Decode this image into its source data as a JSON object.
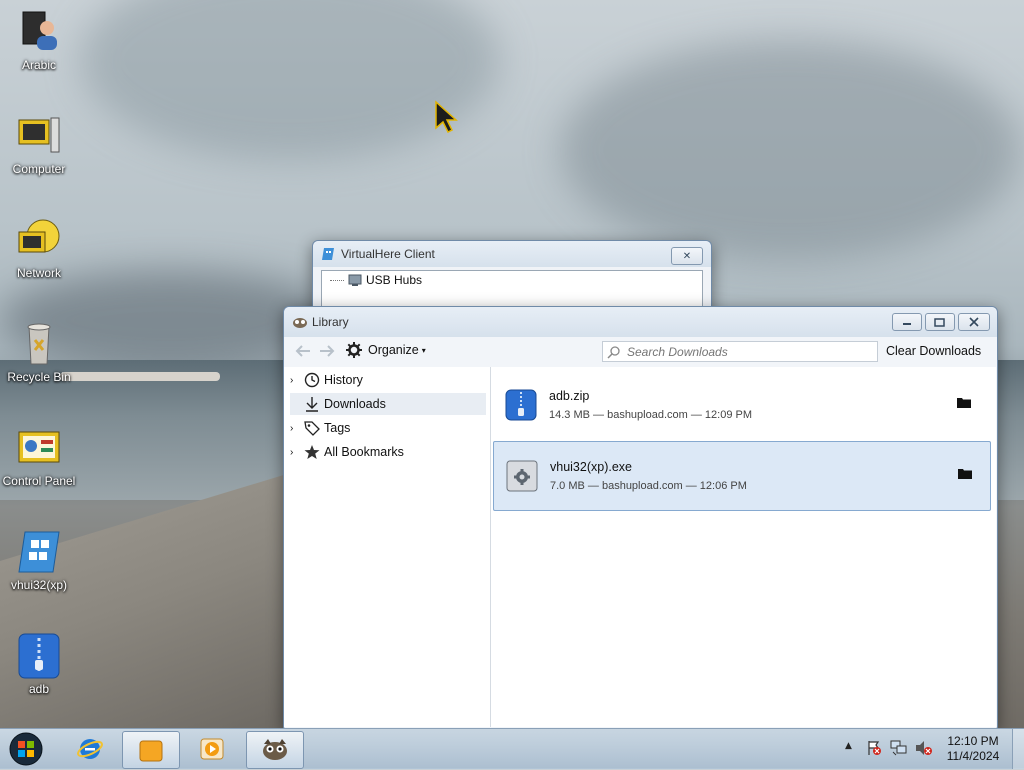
{
  "desktop": {
    "icons": [
      {
        "label": "Arabic",
        "icon": "user-folder-icon"
      },
      {
        "label": "Computer",
        "icon": "computer-icon"
      },
      {
        "label": "Network",
        "icon": "network-icon"
      },
      {
        "label": "Recycle Bin",
        "icon": "recycle-bin-icon"
      },
      {
        "label": "Control Panel",
        "icon": "control-panel-icon"
      },
      {
        "label": "vhui32(xp)",
        "icon": "virtualhere-icon"
      },
      {
        "label": "adb",
        "icon": "zip-archive-icon"
      }
    ]
  },
  "virtualhere": {
    "title": "VirtualHere Client",
    "tree_root": "USB Hubs",
    "close_label": "✕"
  },
  "library": {
    "title": "Library",
    "organize_label": "Organize",
    "search_placeholder": "Search Downloads",
    "clear_label": "Clear Downloads",
    "sidebar": [
      {
        "label": "History",
        "expandable": true,
        "icon": "clock-icon"
      },
      {
        "label": "Downloads",
        "expandable": false,
        "icon": "download-arrow-icon",
        "selected": true
      },
      {
        "label": "Tags",
        "expandable": true,
        "icon": "tag-icon"
      },
      {
        "label": "All Bookmarks",
        "expandable": true,
        "icon": "star-icon"
      }
    ],
    "downloads": [
      {
        "name": "adb.zip",
        "meta": "14.3 MB — bashupload.com — 12:09 PM",
        "icon": "zip-archive-icon"
      },
      {
        "name": "vhui32(xp).exe",
        "meta": "7.0 MB — bashupload.com — 12:06 PM",
        "icon": "executable-icon",
        "selected": true
      }
    ]
  },
  "taskbar": {
    "clock_time": "12:10 PM",
    "clock_date": "11/4/2024",
    "pinned": [
      "start-orb-icon",
      "internet-explorer-icon",
      "file-explorer-icon",
      "media-player-icon",
      "firefox-library-icon"
    ],
    "tray": [
      "show-hidden-icons-icon",
      "action-center-icon",
      "network-tray-icon",
      "volume-muted-icon"
    ]
  },
  "colors": {
    "accent": "#3b78c4",
    "selection": "#dce8f6",
    "window_border": "#6f8aa8"
  }
}
